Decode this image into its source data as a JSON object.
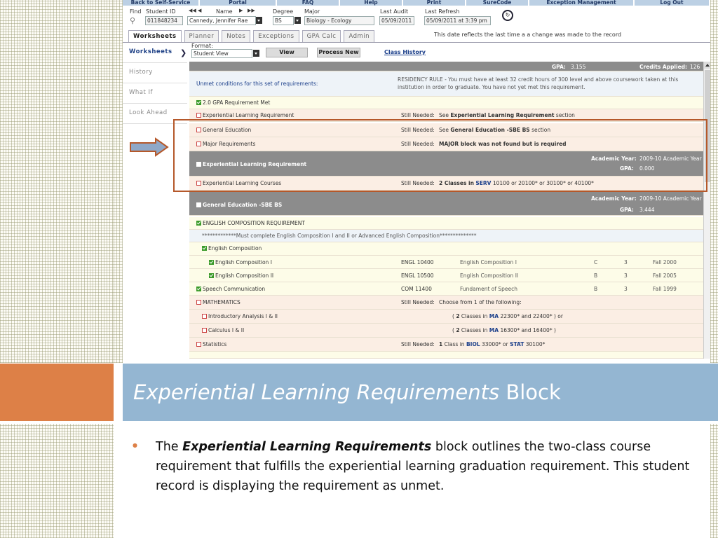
{
  "topnav": [
    "Back to Self-Service",
    "Portal",
    "FAQ",
    "Help",
    "Print",
    "SureCode",
    "Exception Management",
    "Log Out"
  ],
  "student": {
    "find_label": "Find",
    "id_label": "Student ID",
    "id_value": "011848234",
    "nav_first": "◀◀",
    "nav_prev": "◀",
    "name_label": "Name",
    "nav_next": "▶",
    "nav_last": "▶▶",
    "name_value": "Cannedy, Jennifer Rae",
    "degree_label": "Degree",
    "degree_value": "BS",
    "major_label": "Major",
    "major_value": "Biology - Ecology",
    "last_audit_label": "Last Audit",
    "last_audit_value": "05/09/2011",
    "last_refresh_label": "Last Refresh",
    "last_refresh_value": "05/09/2011 at 3:39 pm"
  },
  "tabs": [
    "Worksheets",
    "Planner",
    "Notes",
    "Exceptions",
    "GPA Calc",
    "Admin"
  ],
  "tab_note": "This date reflects the last time a a change was made to the record",
  "sidebar": [
    "Worksheets",
    "History",
    "What If",
    "Look Ahead"
  ],
  "format": {
    "label": "Format:",
    "value": "Student View",
    "view_button": "View",
    "process_button": "Process New",
    "class_history_link": "Class History"
  },
  "worksheet": {
    "gpa_label": "GPA:",
    "gpa_value": "3.155",
    "credits_label": "Credits Applied:",
    "credits_value": "126",
    "unmet_label": "Unmet conditions for this set of requirements:",
    "residency_note": "RESIDENCY RULE - You must have at least 32 credit hours of 300 level and above coursework taken at this institution in order to graduate. You have not yet met this requirement.",
    "gpa_req": "2.0 GPA Requirement Met",
    "still_needed": "Still Needed:",
    "exp_req": "Experiential Learning Requirement",
    "exp_req_note_pre": "See",
    "exp_req_note_bold": "Experiential Learning Requirement",
    "exp_req_note_post": "section",
    "gen_ed": "General Education",
    "gen_ed_note_bold": "General Education -SBE BS",
    "gen_ed_note_post": "section",
    "major_req": "Major Requirements",
    "major_note": "MAJOR block was not found but is required",
    "exp_block": "Experiential Learning Requirement",
    "academic_year_label": "Academic Year:",
    "exp_year": "2009-10 Academic Year",
    "exp_gpa": "0.000",
    "exp_courses": "Experiential Learning Courses",
    "exp_courses_note_pre": "2 Classes in",
    "exp_courses_note_subj": "SERV",
    "exp_courses_note_nums": "10100 or 20100* or 30100* or 40100*",
    "gen_block": "General Education -SBE BS",
    "gen_year": "2009-10 Academic Year",
    "gen_gpa": "3.444",
    "eng_comp_req": "ENGLISH COMPOSITION REQUIREMENT",
    "eng_comp_note": "*************Must complete English Composition I and II or Advanced English Composition**************",
    "eng_comp": "English Composition",
    "courses": [
      {
        "name": "English Composition I",
        "code": "ENGL 10400",
        "title": "English Composition I",
        "grade": "C",
        "credits": "3",
        "term": "Fall 2000"
      },
      {
        "name": "English Composition II",
        "code": "ENGL 10500",
        "title": "English Composition II",
        "grade": "B",
        "credits": "3",
        "term": "Fall 2005"
      },
      {
        "name": "Speech Communication",
        "code": "COM 11400",
        "title": "Fundament of Speech",
        "grade": "B",
        "credits": "3",
        "term": "Fall 1999"
      }
    ],
    "math": "MATHEMATICS",
    "math_note": "Choose from 1 of the following:",
    "intro_analysis": "Introductory Analysis I & II",
    "intro_note_a": "2",
    "intro_note_b": "Classes in",
    "intro_note_subj": "MA",
    "intro_note_nums": "22300* and 22400* ) or",
    "calculus": "Calculus I & II",
    "calc_note_nums": "16300* and 16400* )",
    "statistics": "Statistics",
    "stats_note_a": "1",
    "stats_note_b": "Class in",
    "stats_note_subj1": "BIOL",
    "stats_note_mid": "33000* or",
    "stats_note_subj2": "STAT",
    "stats_note_end": "30100*"
  },
  "slide": {
    "title_italic": "Experiential Learning Requirements",
    "title_plain": "Block",
    "body_pre": "The",
    "body_bold": "Experiential Learning Requirements",
    "body_post": "block outlines the two-class course requirement that fulfills the experiential learning graduation requirement.  This student record is displaying the requirement as unmet."
  },
  "colors": {
    "accent_orange": "#dd8047",
    "title_blue": "#94b6d2",
    "highlight": "#b5582a",
    "needed_red": "#cc2200"
  }
}
